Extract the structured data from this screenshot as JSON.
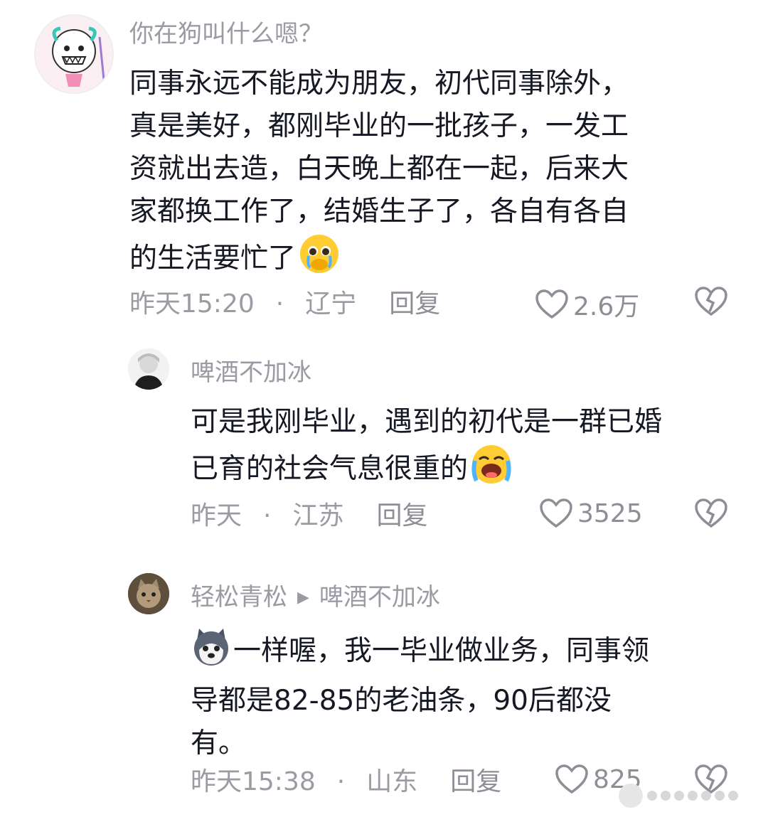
{
  "comments": [
    {
      "username": "你在狗叫什么嗯？",
      "text_lines": [
        "同事永远不能成为朋友，初代同事除外，",
        "真是美好，都刚毕业的一批孩子，一发工",
        "资就出去造，白天晚上都在一起，后来大",
        "家都换工作了，结婚生子了，各自有各自"
      ],
      "text_last": "的生活要忙了",
      "time": "昨天15:20",
      "location": "辽宁",
      "reply_label": "回复",
      "likes": "2.6万"
    },
    {
      "username": "啤酒不加冰",
      "text_lines": [
        "可是我刚毕业，遇到的初代是一群已婚"
      ],
      "text_last": "已育的社会气息很重的",
      "time": "昨天",
      "location": "江苏",
      "reply_label": "回复",
      "likes": "3525"
    },
    {
      "username": "轻松青松",
      "reply_to": "啤酒不加冰",
      "text_first": "一样喔，我一毕业做业务，同事领",
      "text_lines": [
        "导都是82-85的老油条，90后都没",
        "有。"
      ],
      "time": "昨天15:38",
      "location": "山东",
      "reply_label": "回复",
      "likes": "825"
    }
  ],
  "colors": {
    "text": "#161823",
    "meta": "#9a9ba3",
    "background": "#ffffff"
  }
}
